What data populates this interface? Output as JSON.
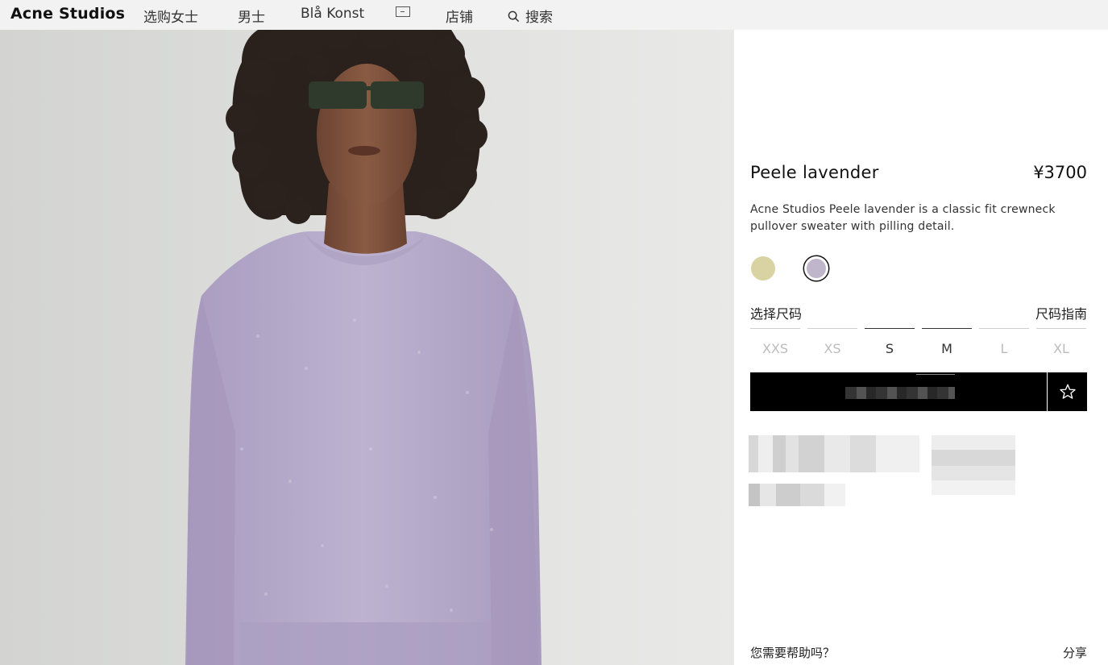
{
  "nav": {
    "brand": "Acne Studios",
    "women": "选购女士",
    "men": "男士",
    "bla_konst": "Blå Konst",
    "stores": "店铺",
    "search": "搜索"
  },
  "product": {
    "name": "Peele lavender",
    "price": "¥3700",
    "description": "Acne Studios Peele lavender is a classic fit crewneck pullover sweater with pilling detail.",
    "colors": [
      {
        "name": "yellow-swatch",
        "hex": "#d9d3a3",
        "selected": false
      },
      {
        "name": "lavender-swatch",
        "hex": "#bfb6cc",
        "selected": true
      }
    ]
  },
  "sizes": {
    "label": "选择尺码",
    "guide": "尺码指南",
    "options": [
      {
        "label": "XXS",
        "available": false
      },
      {
        "label": "XS",
        "available": false
      },
      {
        "label": "S",
        "available": true
      },
      {
        "label": "M",
        "available": true
      },
      {
        "label": "L",
        "available": false
      },
      {
        "label": "XL",
        "available": false
      }
    ]
  },
  "footer": {
    "help": "您需要帮助吗？",
    "share": "分享"
  },
  "colors": {
    "topbar_bg": "#f2f2f2",
    "button_bg": "#000000",
    "sweater": "#b9aecd"
  }
}
